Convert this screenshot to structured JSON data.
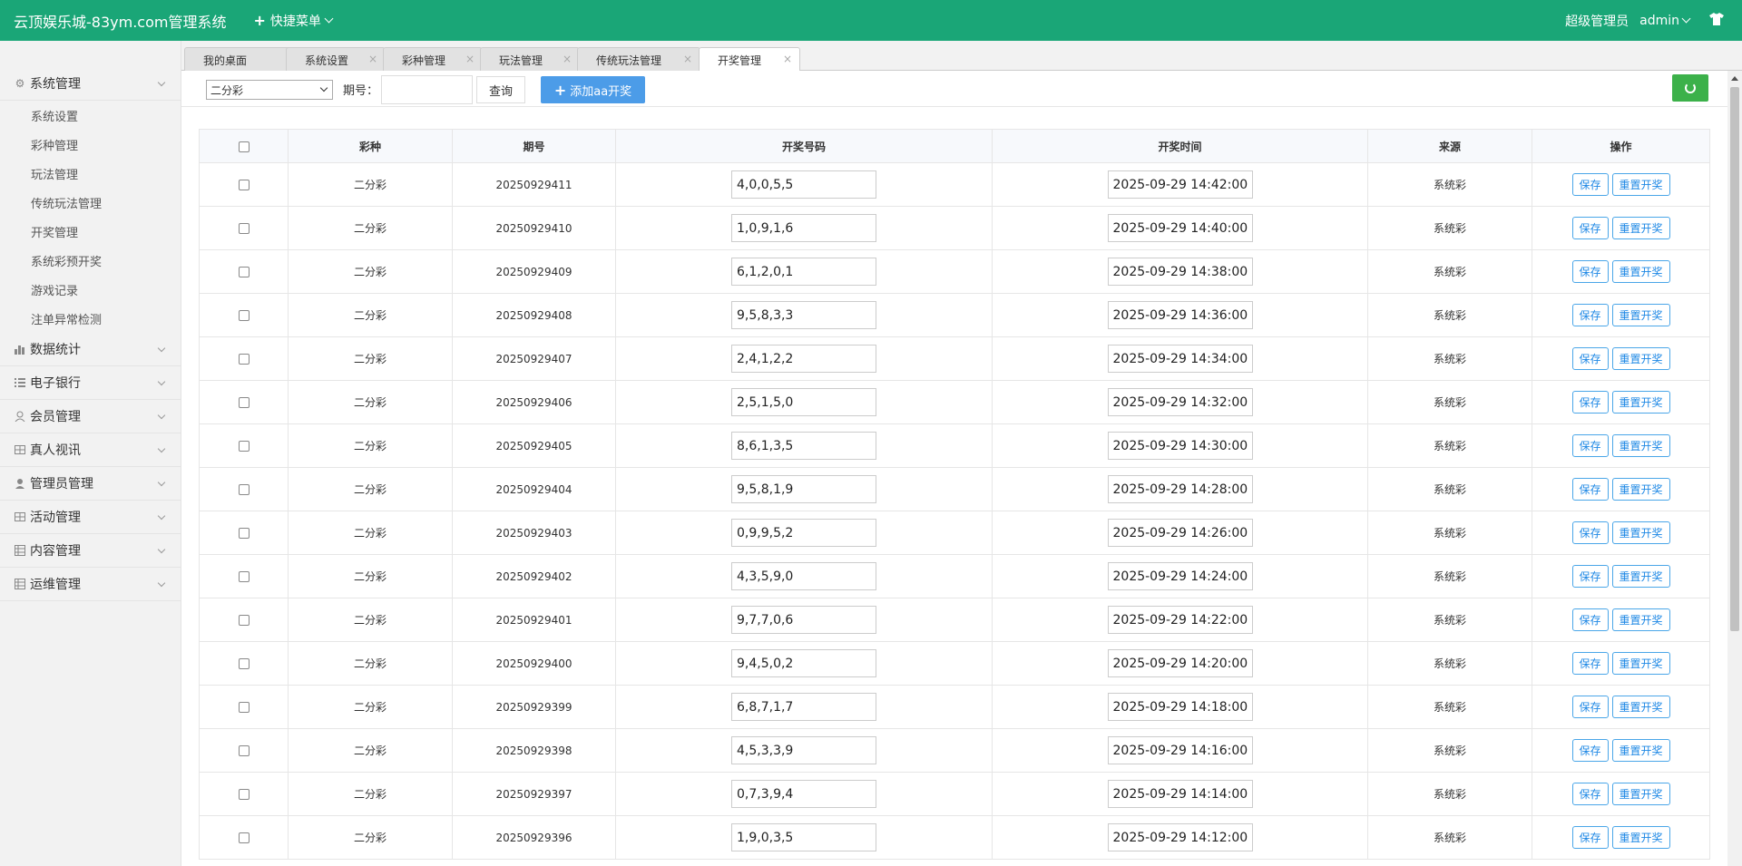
{
  "header": {
    "title": "云顶娱乐城-83ym.com管理系统",
    "quick_menu": "快捷菜单",
    "role": "超级管理员",
    "user": "admin"
  },
  "sidebar": {
    "groups": [
      {
        "label": "系统管理",
        "icon": "gear-icon"
      },
      {
        "label": "数据统计",
        "icon": "bar-chart-icon"
      },
      {
        "label": "电子银行",
        "icon": "list-icon"
      },
      {
        "label": "会员管理",
        "icon": "user-icon"
      },
      {
        "label": "真人视讯",
        "icon": "grid-icon"
      },
      {
        "label": "管理员管理",
        "icon": "admin-icon"
      },
      {
        "label": "活动管理",
        "icon": "grid-icon"
      },
      {
        "label": "内容管理",
        "icon": "table-icon"
      },
      {
        "label": "运维管理",
        "icon": "table-icon"
      }
    ],
    "items": [
      "系统设置",
      "彩种管理",
      "玩法管理",
      "传统玩法管理",
      "开奖管理",
      "系统彩预开奖",
      "游戏记录",
      "注单异常检测"
    ]
  },
  "tabs": [
    {
      "label": "我的桌面"
    },
    {
      "label": "系统设置"
    },
    {
      "label": "彩种管理"
    },
    {
      "label": "玩法管理"
    },
    {
      "label": "传统玩法管理"
    },
    {
      "label": "开奖管理"
    }
  ],
  "tab_close": "×",
  "toolbar": {
    "lottery_select": "二分彩",
    "issue_label": "期号：",
    "issue_value": "",
    "query_button": "查询",
    "add_button": "添加aa开奖"
  },
  "table": {
    "headers": [
      "彩种",
      "期号",
      "开奖号码",
      "开奖时间",
      "来源",
      "操作"
    ],
    "save_label": "保存",
    "reset_label": "重置开奖",
    "rows": [
      {
        "lottery": "二分彩",
        "issue": "20250929411",
        "numbers": "4,0,0,5,5",
        "time": "2025-09-29 14:42:00",
        "source": "系统彩"
      },
      {
        "lottery": "二分彩",
        "issue": "20250929410",
        "numbers": "1,0,9,1,6",
        "time": "2025-09-29 14:40:00",
        "source": "系统彩"
      },
      {
        "lottery": "二分彩",
        "issue": "20250929409",
        "numbers": "6,1,2,0,1",
        "time": "2025-09-29 14:38:00",
        "source": "系统彩"
      },
      {
        "lottery": "二分彩",
        "issue": "20250929408",
        "numbers": "9,5,8,3,3",
        "time": "2025-09-29 14:36:00",
        "source": "系统彩"
      },
      {
        "lottery": "二分彩",
        "issue": "20250929407",
        "numbers": "2,4,1,2,2",
        "time": "2025-09-29 14:34:00",
        "source": "系统彩"
      },
      {
        "lottery": "二分彩",
        "issue": "20250929406",
        "numbers": "2,5,1,5,0",
        "time": "2025-09-29 14:32:00",
        "source": "系统彩"
      },
      {
        "lottery": "二分彩",
        "issue": "20250929405",
        "numbers": "8,6,1,3,5",
        "time": "2025-09-29 14:30:00",
        "source": "系统彩"
      },
      {
        "lottery": "二分彩",
        "issue": "20250929404",
        "numbers": "9,5,8,1,9",
        "time": "2025-09-29 14:28:00",
        "source": "系统彩"
      },
      {
        "lottery": "二分彩",
        "issue": "20250929403",
        "numbers": "0,9,9,5,2",
        "time": "2025-09-29 14:26:00",
        "source": "系统彩"
      },
      {
        "lottery": "二分彩",
        "issue": "20250929402",
        "numbers": "4,3,5,9,0",
        "time": "2025-09-29 14:24:00",
        "source": "系统彩"
      },
      {
        "lottery": "二分彩",
        "issue": "20250929401",
        "numbers": "9,7,7,0,6",
        "time": "2025-09-29 14:22:00",
        "source": "系统彩"
      },
      {
        "lottery": "二分彩",
        "issue": "20250929400",
        "numbers": "9,4,5,0,2",
        "time": "2025-09-29 14:20:00",
        "source": "系统彩"
      },
      {
        "lottery": "二分彩",
        "issue": "20250929399",
        "numbers": "6,8,7,1,7",
        "time": "2025-09-29 14:18:00",
        "source": "系统彩"
      },
      {
        "lottery": "二分彩",
        "issue": "20250929398",
        "numbers": "4,5,3,3,9",
        "time": "2025-09-29 14:16:00",
        "source": "系统彩"
      },
      {
        "lottery": "二分彩",
        "issue": "20250929397",
        "numbers": "0,7,3,9,4",
        "time": "2025-09-29 14:14:00",
        "source": "系统彩"
      },
      {
        "lottery": "二分彩",
        "issue": "20250929396",
        "numbers": "1,9,0,3,5",
        "time": "2025-09-29 14:12:00",
        "source": "系统彩"
      }
    ]
  }
}
